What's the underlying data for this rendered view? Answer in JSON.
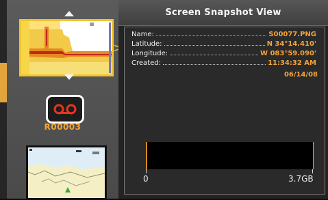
{
  "left": {
    "recording_label": "R00003",
    "selected_thumbnail_icon": "sonar-screenshot-thumbnail",
    "second_thumbnail_icon": "map-screenshot-thumbnail"
  },
  "panel": {
    "title": "Screen Snapshot View",
    "fields": [
      {
        "label": "Name:",
        "value": "S00077.PNG"
      },
      {
        "label": "Latitude:",
        "value": "N 34°14.410'"
      },
      {
        "label": "Longitude:",
        "value": "W 083°59.090'"
      },
      {
        "label": "Created:",
        "value": "11:34:32 AM"
      }
    ],
    "created_date": "06/14/08",
    "storage": {
      "min_label": "0",
      "max_label": "3.7GB",
      "used_fraction": 0.0
    }
  },
  "colors": {
    "accent": "#f2a33c",
    "selection": "#f2c52d"
  }
}
